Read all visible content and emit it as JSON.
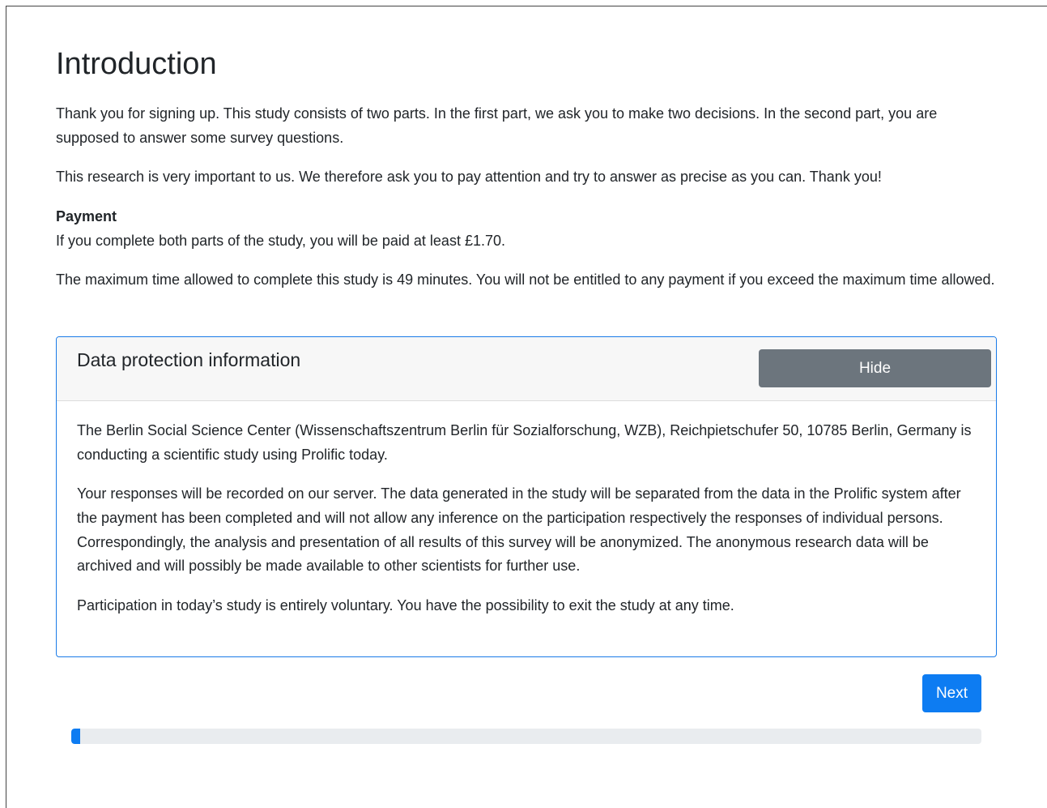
{
  "page": {
    "title": "Introduction",
    "intro_paragraphs": [
      "Thank you for signing up. This study consists of two parts. In the first part, we ask you to make two decisions. In the second part, you are supposed to answer some survey questions.",
      "This research is very important to us. We therefore ask you to pay attention and try to answer as precise as you can. Thank you!"
    ],
    "payment": {
      "heading": "Payment",
      "text": "If you complete both parts of the study, you will be paid at least £1.70."
    },
    "time_limit": "The maximum time allowed to complete this study is 49 minutes. You will not be entitled to any payment if you exceed the maximum time allowed."
  },
  "data_protection": {
    "title": "Data protection information",
    "hide_label": "Hide",
    "paragraphs": [
      "The Berlin Social Science Center (Wissenschaftszentrum Berlin für Sozialforschung, WZB), Reichpietschufer 50, 10785 Berlin, Germany is conducting a scientific study using Prolific today.",
      "Your responses will be recorded on our server. The data generated in the study will be separated from the data in the Prolific system after the payment has been completed and will not allow any inference on the participation respectively the responses of individual persons. Correspondingly, the analysis and presentation of all results of this survey will be anonymized. The anonymous research data will be archived and will possibly be made available to other scientists for further use.",
      "Participation in today’s study is entirely voluntary. You have the possibility to exit the study at any time."
    ]
  },
  "navigation": {
    "next_label": "Next"
  },
  "progress": {
    "fraction": 0.01
  },
  "colors": {
    "primary": "#0d7cf2",
    "secondary": "#6c757d",
    "card_border": "#1a7be8",
    "progress_track": "#e9ecef"
  }
}
